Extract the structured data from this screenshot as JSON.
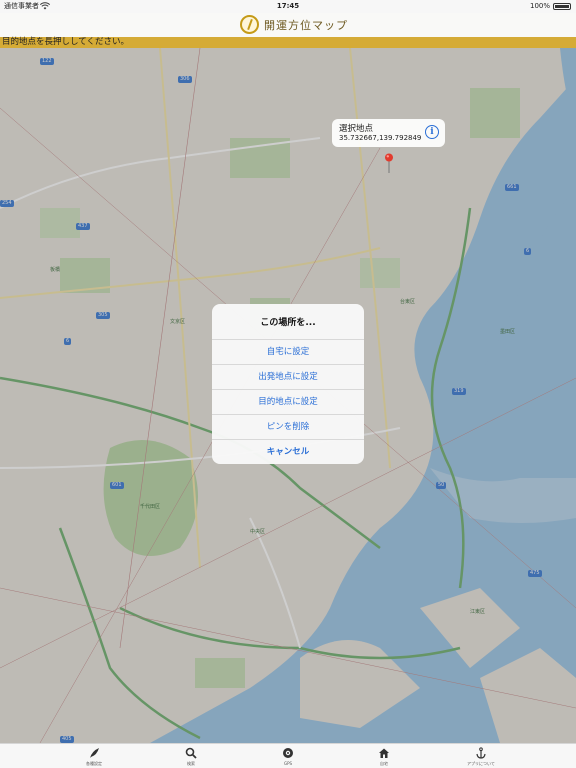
{
  "status_bar": {
    "carrier": "通信事業者",
    "time": "17:45",
    "battery": "100%"
  },
  "nav": {
    "title": "開運方位マップ"
  },
  "banner": {
    "text": "目的地点を長押ししてください。"
  },
  "map": {
    "road_numbers": [
      "122",
      "306",
      "254",
      "437",
      "305",
      "6",
      "601",
      "319",
      "50",
      "475",
      "661",
      "6",
      "405"
    ],
    "place_labels": [
      "板橋",
      "文京区",
      "千代田区",
      "中央区",
      "江東区",
      "台東区",
      "墨田区"
    ]
  },
  "callout": {
    "title": "選択地点",
    "coords": "35.732667,139.792849",
    "info_icon": "i"
  },
  "alert": {
    "title": "この場所を...",
    "set_home": "自宅に設定",
    "set_departure": "出発地点に設定",
    "set_destination": "目的地点に設定",
    "delete_pin": "ピンを削除",
    "cancel": "キャンセル"
  },
  "tabs": [
    {
      "label": "各種設定",
      "icon": "feather-icon"
    },
    {
      "label": "検索",
      "icon": "search-icon"
    },
    {
      "label": "GPS",
      "icon": "gps-icon"
    },
    {
      "label": "自宅",
      "icon": "home-icon"
    },
    {
      "label": "アプリについて",
      "icon": "anchor-icon"
    }
  ],
  "colors": {
    "accent": "#2b6fd6",
    "banner": "#d5ab36",
    "logo": "#c59b18",
    "pin": "#e23b2e"
  }
}
